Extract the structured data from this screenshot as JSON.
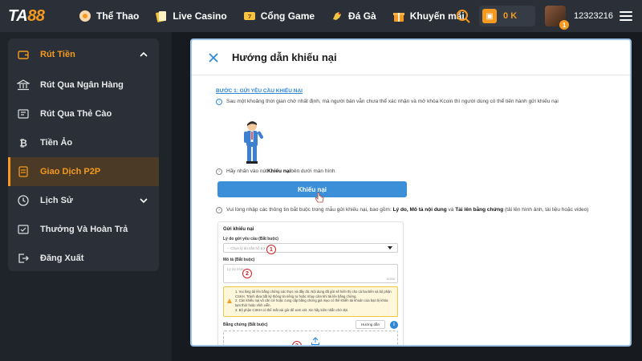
{
  "header": {
    "logo_main": "TA",
    "logo_num": "88",
    "nav": [
      {
        "label": "Thể Thao",
        "icon": "sports-ball-icon",
        "color": "#f59a1e"
      },
      {
        "label": "Live Casino",
        "icon": "cards-icon",
        "color": "#f5c542"
      },
      {
        "label": "Cổng Game",
        "icon": "slot-icon",
        "color": "#f5c542"
      },
      {
        "label": "Đá Gà",
        "icon": "rooster-icon",
        "color": "#f5c542"
      },
      {
        "label": "Khuyến mãi",
        "icon": "gift-icon",
        "color": "#f59a1e"
      }
    ],
    "balance": "0 K",
    "avatar_badge": "1",
    "user_id": "12323216"
  },
  "sidebar": {
    "items": [
      {
        "label": "Rút Tiền",
        "icon": "wallet-out-icon",
        "type": "header"
      },
      {
        "label": "Rút Qua Ngân Hàng",
        "icon": "bank-icon"
      },
      {
        "label": "Rút Qua Thẻ Cào",
        "icon": "card-icon"
      },
      {
        "label": "Tiền Ảo",
        "icon": "bitcoin-icon"
      },
      {
        "label": "Giao Dịch P2P",
        "icon": "p2p-icon",
        "type": "active"
      },
      {
        "label": "Lịch Sử",
        "icon": "history-icon"
      },
      {
        "label": "Thưởng Và Hoàn Trả",
        "icon": "reward-icon"
      },
      {
        "label": "Đăng Xuất",
        "icon": "logout-icon"
      }
    ]
  },
  "card": {
    "title": "Hướng dẫn khiếu nại",
    "step_title": "BƯỚC 1: GỬI YÊU CẦU KHIẾU NẠI",
    "info_text": "Sau một khoảng thời gian chờ nhất định, mà người bán vẫn chưa thể xác nhận và mở khóa Kcoin thì người dùng có thể tiến hành gửi khiếu nại",
    "instruction_1_pre": "Hãy nhấn vào nút ",
    "instruction_1_bold": "Khiếu nại",
    "instruction_1_post": " bên dưới màn hình",
    "cta_label": "Khiếu nại",
    "instruction_2_pre": "Vui lòng nhập các thông tin bắt buộc trong mẫu gửi khiếu nại, bao gồm: ",
    "instruction_2_bold1": "Lý do, Mô tả nội dung",
    "instruction_2_mid": " và ",
    "instruction_2_bold2": "Tải lên bằng chứng",
    "instruction_2_post": " (tải lên hình ảnh, tài liệu hoặc video)"
  },
  "form": {
    "title": "Gửi khiếu nại",
    "reason_label": "Lý do gửi yêu cầu (Bắt buộc)",
    "reason_placeholder": "-- Chọn lý do cần hỗ trợ --",
    "desc_label": "Mô tả (Bắt buộc)",
    "desc_placeholder": "Lý do khác",
    "desc_counter": "0/200",
    "warnings": [
      "1. Vui lòng tải lên bằng chứng xác thực và đầy đủ. Nội dung đã gửi sẽ hiển thị cho cả hai bên và bộ phận",
      "CSKH. Tránh đưa bất kỳ thông tin riêng tư hoặc nhạy cảm khi tải lên bằng chứng.",
      "2. Cản khiếu nại vô căn cứ hoặc cung cấp bằng chứng giả mạo có thể khiến tài khoản của bạn bị khóa",
      "tạm thời hoặc vĩnh viễn.",
      "3. Bộ phận CSKH có thể mất vài giờ để xem xét. Xin hãy kiên nhẫn chờ đợi."
    ],
    "evidence_label": "Bằng chứng (Bắt buộc)",
    "guide_label": "Hướng dẫn",
    "guide_info": "i",
    "markers": [
      "1",
      "2",
      "3"
    ]
  }
}
